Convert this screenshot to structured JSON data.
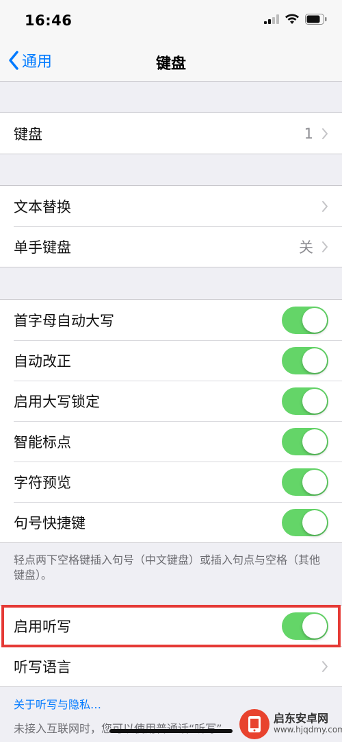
{
  "status_bar": {
    "time": "16:46",
    "icons": [
      "cellular-signal-icon",
      "wifi-icon",
      "battery-icon"
    ]
  },
  "nav": {
    "back_label": "通用",
    "title": "键盘"
  },
  "groups": {
    "keyboards": {
      "label": "键盘",
      "value": "1"
    },
    "text": {
      "rows": [
        {
          "label": "文本替换",
          "value": ""
        },
        {
          "label": "单手键盘",
          "value": "关"
        }
      ]
    },
    "toggles": {
      "rows": [
        {
          "label": "首字母自动大写",
          "on": true
        },
        {
          "label": "自动改正",
          "on": true
        },
        {
          "label": "启用大写锁定",
          "on": true
        },
        {
          "label": "智能标点",
          "on": true
        },
        {
          "label": "字符预览",
          "on": true
        },
        {
          "label": "句号快捷键",
          "on": true
        }
      ],
      "footer": "轻点两下空格键插入句号（中文键盘）或插入句点与空格（其他键盘）。"
    },
    "dictation": {
      "enable_label": "启用听写",
      "enable_on": true,
      "language_label": "听写语言",
      "privacy_link": "关于听写与隐私…",
      "footer": "未接入互联网时，您可以使用普通话“听写”"
    }
  },
  "watermark": {
    "title": "启东安卓网",
    "url": "www.hjqdmy.com"
  },
  "colors": {
    "accent": "#007aff",
    "toggle_on": "#64d568",
    "highlight": "#e53935",
    "background": "#efeff4"
  }
}
